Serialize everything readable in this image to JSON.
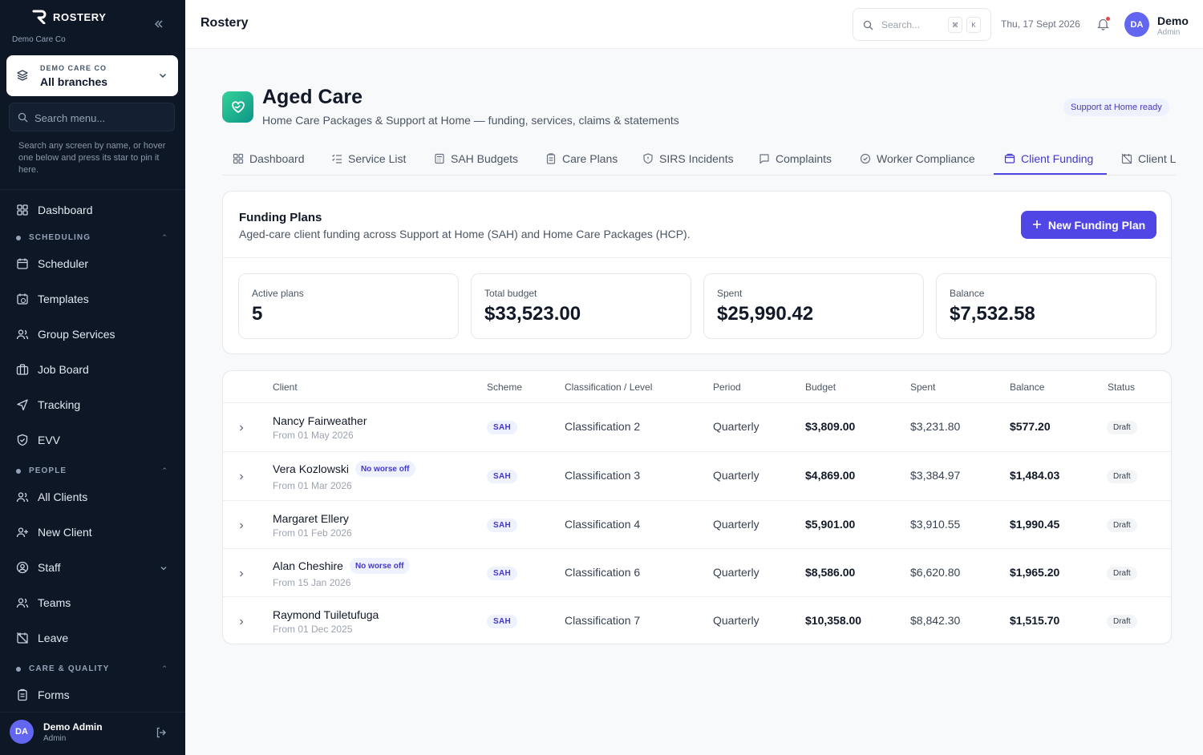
{
  "sidebar": {
    "brand": "ROSTERY",
    "org_name": "Demo Care Co",
    "branch_selector": {
      "org": "DEMO CARE CO",
      "branch": "All branches"
    },
    "search_placeholder": "Search menu...",
    "hint": "Search any screen by name, or hover one below and press its star to pin it here.",
    "sections": {
      "scheduling": "SCHEDULING",
      "people": "PEOPLE",
      "care_quality": "CARE & QUALITY"
    },
    "items": {
      "dashboard": "Dashboard",
      "scheduler": "Scheduler",
      "templates": "Templates",
      "group_services": "Group Services",
      "job_board": "Job Board",
      "tracking": "Tracking",
      "evv": "EVV",
      "all_clients": "All Clients",
      "new_client": "New Client",
      "staff": "Staff",
      "teams": "Teams",
      "leave": "Leave",
      "forms": "Forms"
    },
    "user": {
      "initials": "DA",
      "name": "Demo Admin",
      "role": "Admin"
    }
  },
  "topbar": {
    "title": "Rostery",
    "search_placeholder": "Search...",
    "kbd1": "⌘",
    "kbd2": "K",
    "date": "Thu, 17 Sept 2026",
    "user": {
      "initials": "DA",
      "name": "Demo",
      "role": "Admin"
    }
  },
  "page": {
    "title": "Aged Care",
    "subtitle": "Home Care Packages & Support at Home — funding, services, claims & statements",
    "badge": "Support at Home ready"
  },
  "tabs": [
    {
      "label": "Dashboard",
      "icon": "grid-icon"
    },
    {
      "label": "Service List",
      "icon": "list-icon"
    },
    {
      "label": "SAH Budgets",
      "icon": "calculator-icon"
    },
    {
      "label": "Care Plans",
      "icon": "clipboard-icon"
    },
    {
      "label": "SIRS Incidents",
      "icon": "shield-icon"
    },
    {
      "label": "Complaints",
      "icon": "message-icon"
    },
    {
      "label": "Worker Compliance",
      "icon": "check-circle-icon"
    },
    {
      "label": "Client Funding",
      "icon": "wallet-icon",
      "active": true
    },
    {
      "label": "Client L",
      "icon": "calendar-off-icon"
    }
  ],
  "funding": {
    "title": "Funding Plans",
    "subtitle": "Aged-care client funding across Support at Home (SAH) and Home Care Packages (HCP).",
    "new_button": "New Funding Plan",
    "stats": [
      {
        "label": "Active plans",
        "value": "5"
      },
      {
        "label": "Total budget",
        "value": "$33,523.00"
      },
      {
        "label": "Spent",
        "value": "$25,990.42"
      },
      {
        "label": "Balance",
        "value": "$7,532.58"
      }
    ]
  },
  "table": {
    "headers": {
      "client": "Client",
      "scheme": "Scheme",
      "classification": "Classification / Level",
      "period": "Period",
      "budget": "Budget",
      "spent": "Spent",
      "balance": "Balance",
      "status": "Status"
    },
    "rows": [
      {
        "client": "Nancy Fairweather",
        "from": "From 01 May 2026",
        "badge": "",
        "scheme": "SAH",
        "classification": "Classification 2",
        "period": "Quarterly",
        "budget": "$3,809.00",
        "spent": "$3,231.80",
        "balance": "$577.20",
        "status": "Draft"
      },
      {
        "client": "Vera Kozlowski",
        "from": "From 01 Mar 2026",
        "badge": "No worse off",
        "scheme": "SAH",
        "classification": "Classification 3",
        "period": "Quarterly",
        "budget": "$4,869.00",
        "spent": "$3,384.97",
        "balance": "$1,484.03",
        "status": "Draft"
      },
      {
        "client": "Margaret Ellery",
        "from": "From 01 Feb 2026",
        "badge": "",
        "scheme": "SAH",
        "classification": "Classification 4",
        "period": "Quarterly",
        "budget": "$5,901.00",
        "spent": "$3,910.55",
        "balance": "$1,990.45",
        "status": "Draft"
      },
      {
        "client": "Alan Cheshire",
        "from": "From 15 Jan 2026",
        "badge": "No worse off",
        "scheme": "SAH",
        "classification": "Classification 6",
        "period": "Quarterly",
        "budget": "$8,586.00",
        "spent": "$6,620.80",
        "balance": "$1,965.20",
        "status": "Draft"
      },
      {
        "client": "Raymond Tuiletufuga",
        "from": "From 01 Dec 2025",
        "badge": "",
        "scheme": "SAH",
        "classification": "Classification 7",
        "period": "Quarterly",
        "budget": "$10,358.00",
        "spent": "$8,842.30",
        "balance": "$1,515.70",
        "status": "Draft"
      }
    ]
  },
  "colors": {
    "accent": "#4f46e5",
    "sidebar_bg": "#0e1726",
    "brand_teal": "#0d9488"
  }
}
